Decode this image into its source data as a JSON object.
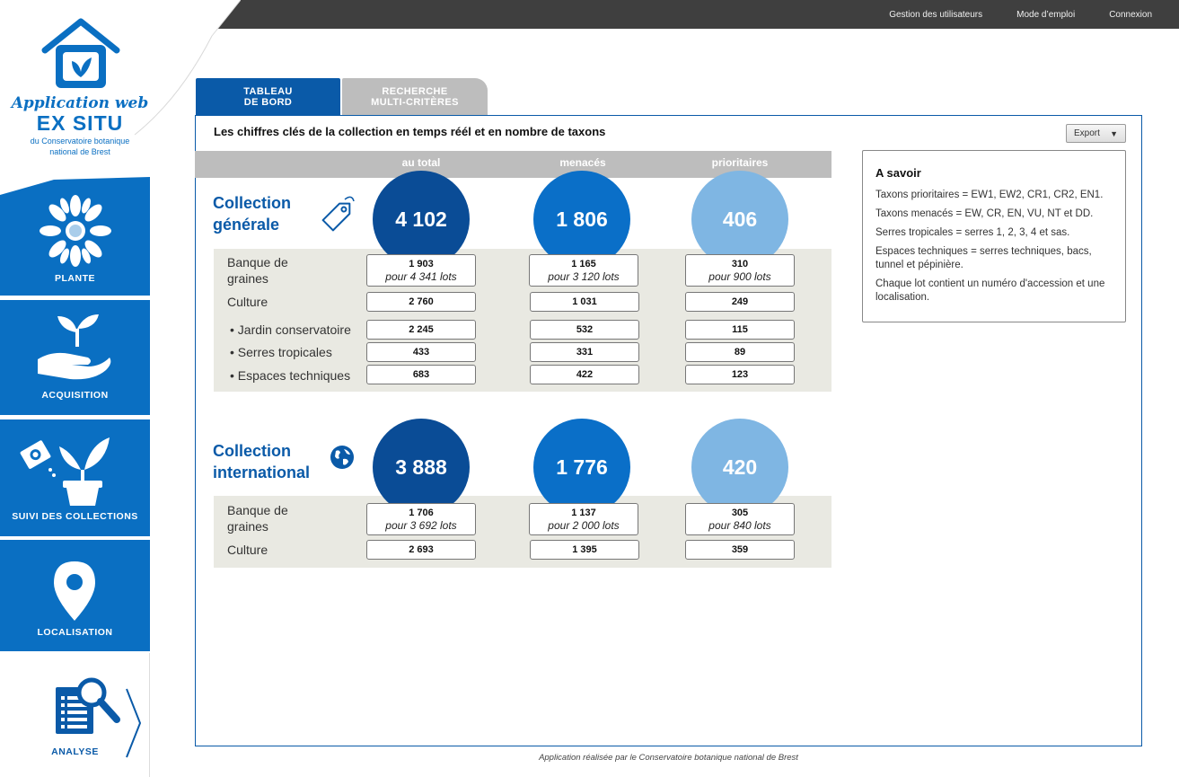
{
  "topnav": {
    "users": "Gestion des utilisateurs",
    "manual": "Mode d’emploi",
    "login": "Connexion"
  },
  "logo": {
    "line1": "Application web",
    "line2": "EX SITU",
    "line3": "du Conservatoire botanique",
    "line4": "national de Brest"
  },
  "sidebar": {
    "items": [
      {
        "label": "PLANTE",
        "icon": "flower-icon"
      },
      {
        "label": "ACQUISITION",
        "icon": "hand-sprout-icon"
      },
      {
        "label": "SUIVI DES COLLECTIONS",
        "icon": "seed-pot-icon"
      },
      {
        "label": "LOCALISATION",
        "icon": "map-pin-icon"
      },
      {
        "label": "ANALYSE",
        "icon": "report-magnifier-icon"
      }
    ]
  },
  "tabs": {
    "dashboard": "TABLEAU\nDE BORD",
    "search": "RECHERCHE\nMULTI-CRITÈRES"
  },
  "main": {
    "title": "Les chiffres clés de la collection en temps réél et en nombre de taxons",
    "export_label": "Export",
    "columns": [
      "au total",
      "menacés",
      "prioritaires"
    ]
  },
  "sections": {
    "general": {
      "title_line1": "Collection",
      "title_line2": "générale",
      "totals": [
        "4 102",
        "1 806",
        "406"
      ],
      "rows": {
        "banque_label_1": "Banque de",
        "banque_label_2": "graines",
        "banque": [
          {
            "value": "1 903",
            "lots": "pour 4 341 lots"
          },
          {
            "value": "1 165",
            "lots": "pour 3 120 lots"
          },
          {
            "value": "310",
            "lots": "pour 900 lots"
          }
        ],
        "culture_label": "Culture",
        "culture": [
          "2 760",
          "1 031",
          "249"
        ],
        "jardin_label": "• Jardin conservatoire",
        "jardin": [
          "2 245",
          "532",
          "115"
        ],
        "serres_label": "• Serres tropicales",
        "serres": [
          "433",
          "331",
          "89"
        ],
        "espaces_label": "• Espaces techniques",
        "espaces": [
          "683",
          "422",
          "123"
        ]
      }
    },
    "international": {
      "title_line1": "Collection",
      "title_line2": "international",
      "totals": [
        "3 888",
        "1 776",
        "420"
      ],
      "rows": {
        "banque_label_1": "Banque de",
        "banque_label_2": "graines",
        "banque": [
          {
            "value": "1 706",
            "lots": "pour 3 692 lots"
          },
          {
            "value": "1 137",
            "lots": "pour 2 000 lots"
          },
          {
            "value": "305",
            "lots": "pour 840 lots"
          }
        ],
        "culture_label": "Culture",
        "culture": [
          "2 693",
          "1 395",
          "359"
        ]
      }
    }
  },
  "info": {
    "title": "A savoir",
    "lines": [
      "Taxons prioritaires = EW1, EW2, CR1, CR2, EN1.",
      "Taxons menacés = EW, CR, EN, VU, NT et DD.",
      "Serres tropicales = serres 1, 2, 3, 4 et sas.",
      "Espaces techniques = serres techniques, bacs, tunnel et pépinière.",
      "Chaque lot contient un numéro d'accession et une localisation."
    ]
  },
  "footer": "Application réalisée par le Conservatoire botanique national de Brest",
  "colors": {
    "brand_blue": "#0a6fc2",
    "dark_blue": "#0a4c96",
    "light_blue": "#7fb6e3",
    "topbar": "#3f3f3f"
  }
}
